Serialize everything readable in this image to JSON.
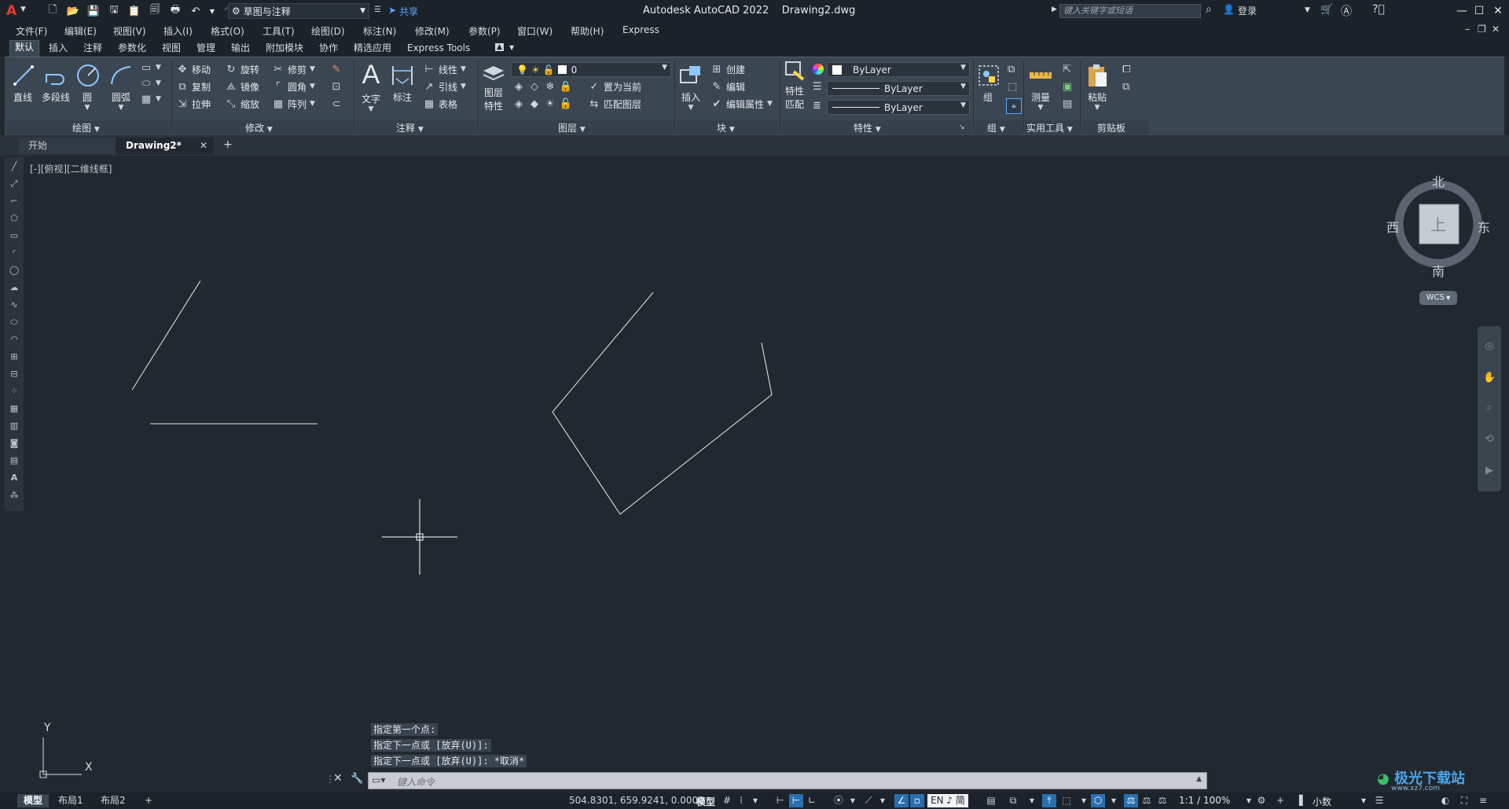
{
  "titlebar": {
    "app_logo": "A",
    "workspace": "草图与注释",
    "share": "共享",
    "title": "Autodesk AutoCAD 2022    Drawing2.dwg",
    "search_placeholder": "键入关键字或短语",
    "login": "登录"
  },
  "menu": [
    "文件(F)",
    "编辑(E)",
    "视图(V)",
    "插入(I)",
    "格式(O)",
    "工具(T)",
    "绘图(D)",
    "标注(N)",
    "修改(M)",
    "参数(P)",
    "窗口(W)",
    "帮助(H)",
    "Express"
  ],
  "ribbon_tabs": [
    "默认",
    "插入",
    "注释",
    "参数化",
    "视图",
    "管理",
    "输出",
    "附加模块",
    "协作",
    "精选应用",
    "Express Tools"
  ],
  "panels": {
    "draw": {
      "title": "绘图",
      "line": "直线",
      "polyline": "多段线",
      "circle": "圆",
      "arc": "圆弧"
    },
    "modify": {
      "title": "修改",
      "move": "移动",
      "rotate": "旋转",
      "trim": "修剪",
      "copy": "复制",
      "mirror": "镜像",
      "fillet": "圆角",
      "stretch": "拉伸",
      "scale": "缩放",
      "array": "阵列"
    },
    "annotation": {
      "title": "注释",
      "text": "文字",
      "dimension": "标注",
      "linear": "线性",
      "leader": "引线",
      "table": "表格"
    },
    "layers": {
      "title": "图层",
      "layer_props_1": "图层",
      "layer_props_2": "特性",
      "current_layer": "0",
      "set_current": "置为当前",
      "match_layer": "匹配图层"
    },
    "block": {
      "title": "块",
      "insert": "插入",
      "create": "创建",
      "edit": "编辑",
      "edit_attr": "编辑属性"
    },
    "properties": {
      "title": "特性",
      "match_1": "特性",
      "match_2": "匹配",
      "color": "ByLayer",
      "linetype": "ByLayer",
      "lineweight": "ByLayer"
    },
    "groups": {
      "title": "组",
      "group": "组"
    },
    "utilities": {
      "title": "实用工具",
      "measure": "测量"
    },
    "clipboard": {
      "title": "剪贴板",
      "paste": "粘贴"
    }
  },
  "doc_tabs": [
    "开始",
    "Drawing2*"
  ],
  "viewport_label": "[-][俯视][二维线框]",
  "viewcube": {
    "north": "北",
    "south": "南",
    "east": "东",
    "west": "西",
    "face": "上",
    "wcs": "WCS"
  },
  "ucs": {
    "x": "X",
    "y": "Y"
  },
  "command_history": [
    "指定第一个点:",
    "指定下一点或 [放弃(U)]:",
    "指定下一点或 [放弃(U)]: *取消*"
  ],
  "command_placeholder": "键入命令",
  "layout_tabs": [
    "模型",
    "布局1",
    "布局2"
  ],
  "status": {
    "coords": "504.8301, 659.9241, 0.0000",
    "model": "模型",
    "ime": "EN ♪ 简",
    "scale": "1:1 / 100%",
    "units": "小数"
  },
  "watermark": {
    "brand": "极光下载站",
    "url": "www.xz7.com"
  },
  "colors": {
    "canvas": "#212830",
    "ribbon": "#3b4653",
    "accent": "#2a6fb0"
  }
}
